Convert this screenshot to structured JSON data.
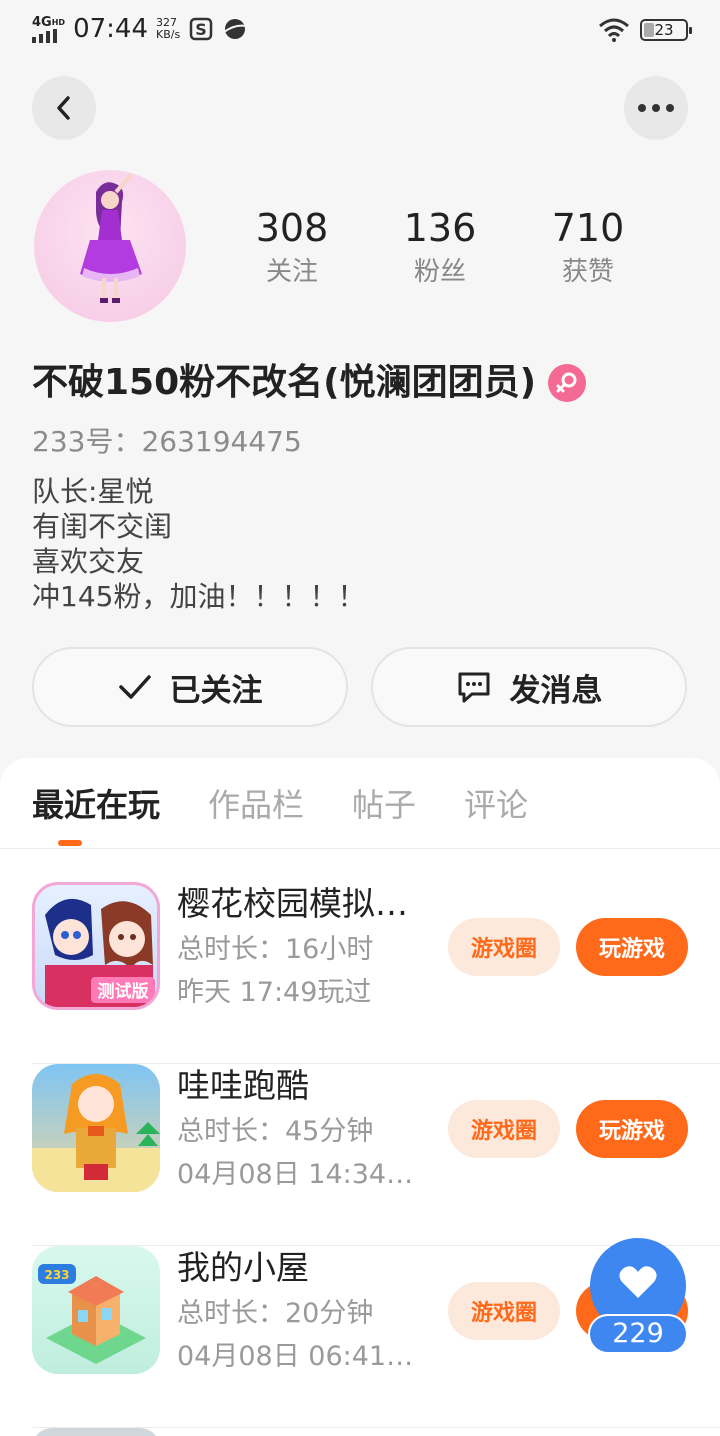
{
  "status_bar": {
    "network": "4G",
    "hd": "HD",
    "time": "07:44",
    "speed_value": "327",
    "speed_unit": "KB/s",
    "battery": "23"
  },
  "profile": {
    "stats": [
      {
        "value": "308",
        "label": "关注"
      },
      {
        "value": "136",
        "label": "粉丝"
      },
      {
        "value": "710",
        "label": "获赞"
      }
    ],
    "username": "不破150粉不改名(悦澜团团员)",
    "uid": "233号：263194475",
    "bio": [
      "队长:星悦",
      "有闺不交闺",
      "喜欢交友",
      "冲145粉，加油！！！！！"
    ],
    "follow_label": "已关注",
    "message_label": "发消息"
  },
  "tabs": [
    "最近在玩",
    "作品栏",
    "帖子",
    "评论"
  ],
  "games": [
    {
      "title": "樱花校园模拟…",
      "duration": "总时长：16小时",
      "last_played": "昨天 17:49玩过",
      "circle_label": "游戏圈",
      "play_label": "玩游戏"
    },
    {
      "title": "哇哇跑酷",
      "duration": "总时长：45分钟",
      "last_played": "04月08日 14:34…",
      "circle_label": "游戏圈",
      "play_label": "玩游戏"
    },
    {
      "title": "我的小屋",
      "duration": "总时长：20分钟",
      "last_played": "04月08日 06:41…",
      "circle_label": "游戏圈",
      "play_label": "玩游戏"
    }
  ],
  "like_fab": {
    "count": "229"
  },
  "colors": {
    "accent": "#ff6a1a",
    "like_blue": "#3e86f0",
    "gender_pink": "#f46a94"
  }
}
